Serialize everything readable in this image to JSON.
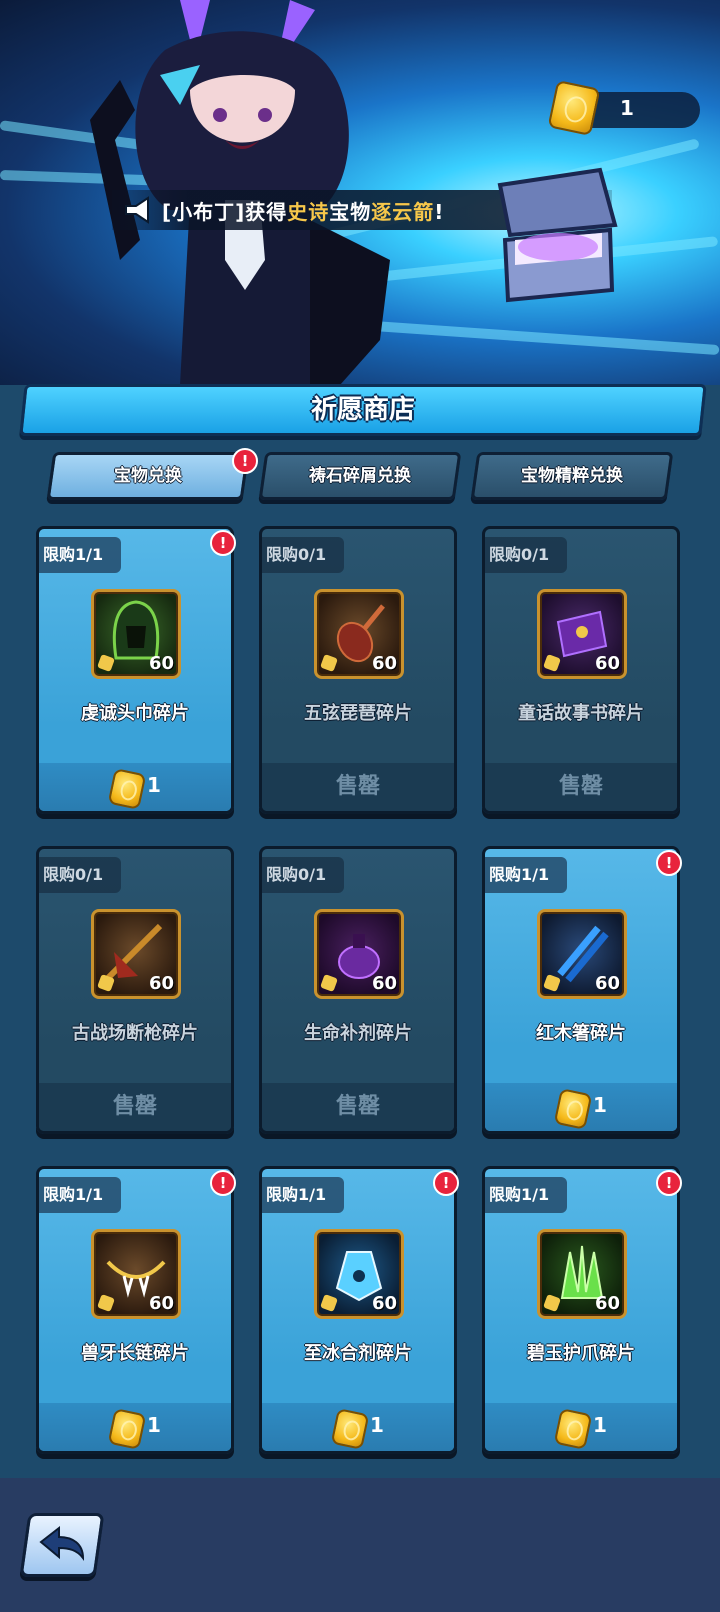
{
  "banner": {
    "announcement_prefix": "[小布丁]获得",
    "announcement_rarity": "史诗",
    "announcement_middle": "宝物",
    "announcement_item": "逐云箭",
    "announcement_suffix": "!",
    "currency_amount": "1",
    "currency_icon": "wish-coin-icon"
  },
  "shop": {
    "title": "祈愿商店"
  },
  "tabs": [
    {
      "label": "宝物兑换",
      "active": true,
      "alert": "!"
    },
    {
      "label": "祷石碎屑兑换",
      "active": false
    },
    {
      "label": "宝物精粹兑换",
      "active": false
    }
  ],
  "items": [
    {
      "limit": "限购1/1",
      "name": "虔诚头巾碎片",
      "qty": "60",
      "price": "1",
      "status": "available",
      "alert": "!"
    },
    {
      "limit": "限购0/1",
      "name": "五弦琵琶碎片",
      "qty": "60",
      "status_text": "售罄",
      "status": "sold"
    },
    {
      "limit": "限购0/1",
      "name": "童话故事书碎片",
      "qty": "60",
      "status_text": "售罄",
      "status": "sold"
    },
    {
      "limit": "限购0/1",
      "name": "古战场断枪碎片",
      "qty": "60",
      "status_text": "售罄",
      "status": "sold"
    },
    {
      "limit": "限购0/1",
      "name": "生命补剂碎片",
      "qty": "60",
      "status_text": "售罄",
      "status": "sold"
    },
    {
      "limit": "限购1/1",
      "name": "红木箸碎片",
      "qty": "60",
      "price": "1",
      "status": "available",
      "alert": "!"
    },
    {
      "limit": "限购1/1",
      "name": "兽牙长链碎片",
      "qty": "60",
      "price": "1",
      "status": "available",
      "alert": "!"
    },
    {
      "limit": "限购1/1",
      "name": "至冰合剂碎片",
      "qty": "60",
      "price": "1",
      "status": "available",
      "alert": "!"
    },
    {
      "limit": "限购1/1",
      "name": "碧玉护爪碎片",
      "qty": "60",
      "price": "1",
      "status": "available",
      "alert": "!"
    }
  ],
  "nav": {
    "back_icon": "back-arrow-icon"
  }
}
